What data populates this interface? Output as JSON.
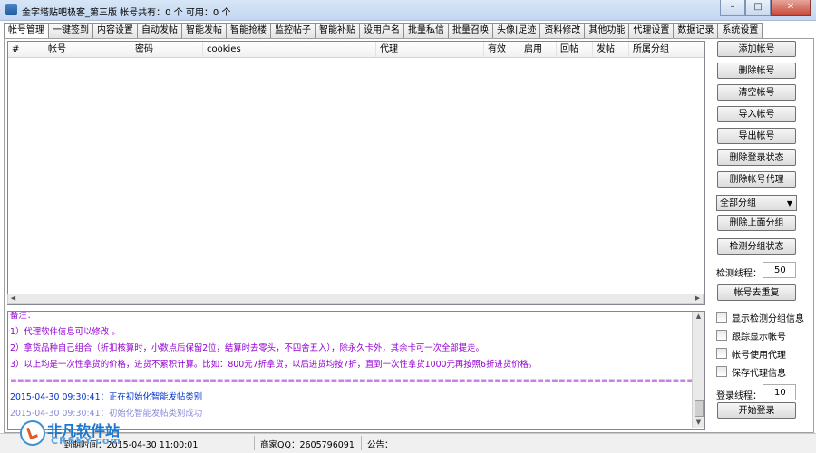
{
  "window": {
    "title": "金字塔贴吧极客_第三版   帐号共有：0 个   可用：0 个",
    "controls": [
      "–",
      "□",
      "✕"
    ]
  },
  "tabs": [
    "帐号管理",
    "一键签到",
    "内容设置",
    "自动发帖",
    "智能发帖",
    "智能抢楼",
    "监控帖子",
    "智能补贴",
    "设用户名",
    "批量私信",
    "批量召唤",
    "头像|足迹",
    "资料修改",
    "其他功能",
    "代理设置",
    "数据记录",
    "系统设置"
  ],
  "active_tab": "帐号管理",
  "table": {
    "columns": [
      "#",
      "帐号",
      "密码",
      "cookies",
      "代理",
      "有效",
      "启用",
      "回帖",
      "发帖",
      "所属分组"
    ]
  },
  "log": [
    {
      "text": "备注：",
      "color": "purple"
    },
    {
      "text": "1）代理软件信息可以修改 。",
      "color": "purple"
    },
    {
      "text": "2）拿货品种自己组合（折扣核算时，小数点后保留2位，结算时去零头，不四舍五入），除永久卡外，其余卡可一次全部提走。",
      "color": "purple"
    },
    {
      "text": "3）以上均是一次性拿货的价格，进货不累积计算。比如：800元7折拿货，以后进货均按7折，直到一次性拿货1000元再按照6折进货价格。",
      "color": "purple"
    },
    {
      "text": "====================================================================================================",
      "color": "purple"
    },
    {
      "text": "2015-04-30 09:30:41：正在初始化智能发帖类别",
      "color": "blue"
    },
    {
      "text": "2015-04-30 09:30:41：初始化智能发帖类别成功",
      "color": "faded"
    }
  ],
  "side": {
    "buttons_top": [
      "添加帐号",
      "删除帐号",
      "清空帐号",
      "导入帐号",
      "导出帐号",
      "删除登录状态",
      "删除帐号代理"
    ],
    "group_select": "全部分组",
    "group_buttons": [
      "删除上面分组",
      "检测分组状态"
    ],
    "check_threads_label": "检测线程：",
    "check_threads_value": "50",
    "dedupe_button": "帐号去重复",
    "checkboxes": [
      "显示检测分组信息",
      "跟踪显示帐号",
      "帐号使用代理",
      "保存代理信息"
    ],
    "login_threads_label": "登录线程：",
    "login_threads_value": "10",
    "start_login_button": "开始登录"
  },
  "status": {
    "expiry": "到期时间：2015-04-30 11:00:01",
    "merchant_qq": "商家QQ：2605796091",
    "notice": "公告："
  },
  "watermark": {
    "line1": "非凡软件站",
    "line2": "CRSKY.com"
  }
}
